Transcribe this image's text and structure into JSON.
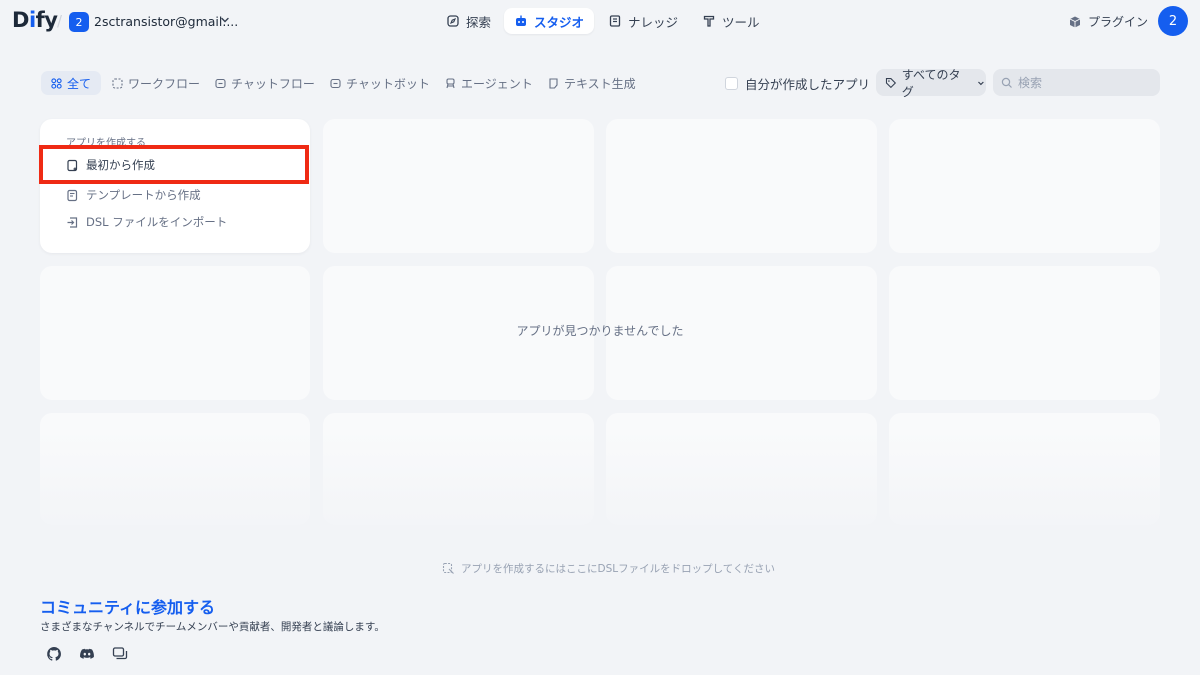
{
  "header": {
    "logo": {
      "text_main": "D",
      "text_dot": "i",
      "text_rest": "fy"
    },
    "workspace": {
      "badge": "2",
      "name": "2sctransistor@gmail...."
    },
    "nav": [
      {
        "label": "探索",
        "icon": "compass-icon"
      },
      {
        "label": "スタジオ",
        "icon": "robot-icon",
        "active": true
      },
      {
        "label": "ナレッジ",
        "icon": "book-icon"
      },
      {
        "label": "ツール",
        "icon": "hammer-icon"
      }
    ],
    "plugins_label": "プラグイン",
    "avatar": "2"
  },
  "filters": [
    {
      "label": "全て",
      "icon": "grid-icon",
      "active": true
    },
    {
      "label": "ワークフロー",
      "icon": "workflow-icon"
    },
    {
      "label": "チャットフロー",
      "icon": "chatflow-icon"
    },
    {
      "label": "チャットボット",
      "icon": "chatbot-icon"
    },
    {
      "label": "エージェント",
      "icon": "agent-icon"
    },
    {
      "label": "テキスト生成",
      "icon": "text-generation-icon"
    }
  ],
  "my_apps_label": "自分が作成したアプリ",
  "tag_select": "すべてのタグ",
  "search_placeholder": "検索",
  "create_card": {
    "title": "アプリを作成する",
    "items": [
      {
        "label": "最初から作成",
        "icon": "new-file-icon"
      },
      {
        "label": "テンプレートから作成",
        "icon": "template-icon"
      },
      {
        "label": "DSL ファイルをインポート",
        "icon": "import-icon"
      }
    ]
  },
  "empty_message": "アプリが見つかりませんでした",
  "drop_hint": "アプリを作成するにはここにDSLファイルをドロップしてください",
  "community": {
    "title": "コミュニティに参加する",
    "subtitle": "さまざまなチャンネルでチームメンバーや貢献者、開発者と議論します。"
  },
  "colors": {
    "accent": "#155eef",
    "highlight": "#ef2a14"
  }
}
